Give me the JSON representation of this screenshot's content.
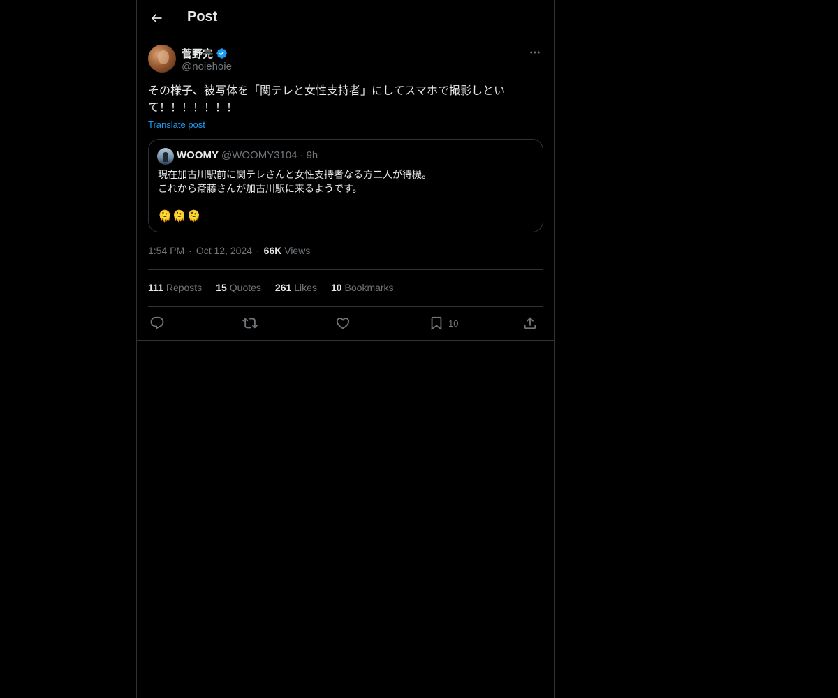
{
  "header": {
    "title": "Post",
    "back_icon": "arrow-left-icon"
  },
  "author": {
    "display_name": "菅野完",
    "handle": "@noiehoie",
    "verified_icon": "verified-badge-icon",
    "more_icon": "more-horizontal-icon"
  },
  "post": {
    "text": "その様子、被写体を「関テレと女性支持者」にしてスマホで撮影しといて！！！！！！！",
    "translate_label": "Translate post"
  },
  "quoted_post": {
    "name": "WOOMY",
    "handle": "@WOOMY3104",
    "separator": "·",
    "time": "9h",
    "text": "現在加古川駅前に関テレさんと女性支持者なる方二人が待機。\nこれから斎藤さんが加古川駅に来るようです。",
    "emoji": "🫠🫠🫠"
  },
  "meta": {
    "time": "1:54 PM",
    "separator": "·",
    "date": "Oct 12, 2024",
    "views_count": "66K",
    "views_label": "Views"
  },
  "stats": {
    "reposts_count": "111",
    "reposts_label": "Reposts",
    "quotes_count": "15",
    "quotes_label": "Quotes",
    "likes_count": "261",
    "likes_label": "Likes",
    "bookmarks_count": "10",
    "bookmarks_label": "Bookmarks"
  },
  "actions": {
    "reply_icon": "reply-icon",
    "repost_icon": "repost-icon",
    "like_icon": "like-icon",
    "bookmark_icon": "bookmark-icon",
    "bookmark_count": "10",
    "share_icon": "share-icon"
  },
  "colors": {
    "background": "#000000",
    "text": "#e7e9ea",
    "secondary": "#71767b",
    "accent": "#1d9bf0",
    "border": "#2f3336"
  }
}
